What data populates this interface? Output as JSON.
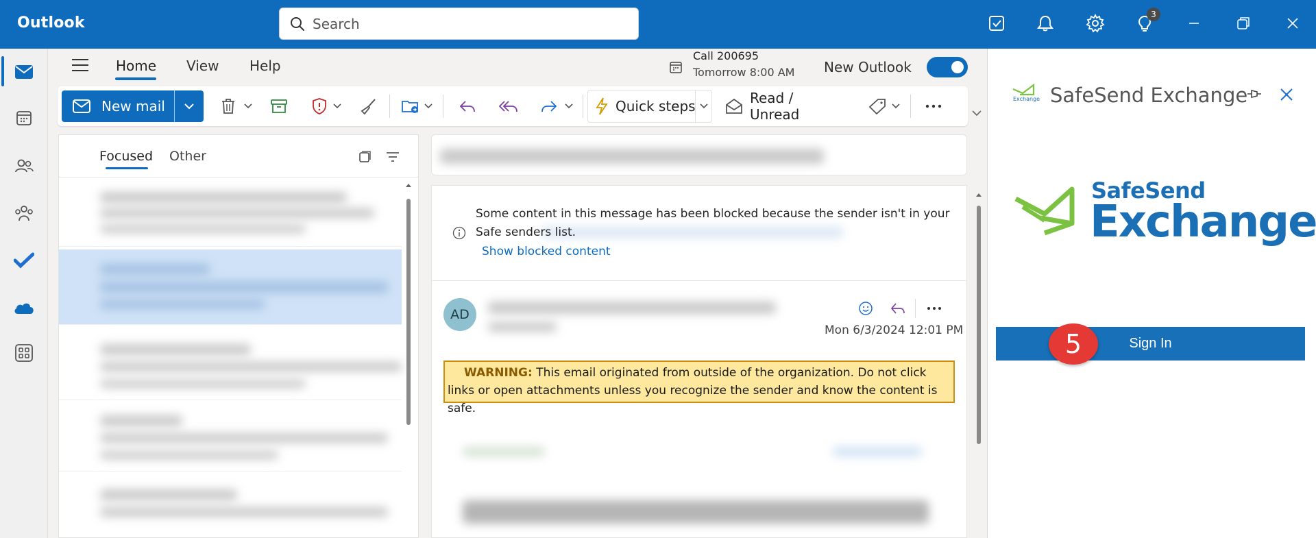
{
  "app": {
    "title": "Outlook",
    "accent_color": "#0f6cbd"
  },
  "search": {
    "placeholder": "Search"
  },
  "titlebar": {
    "icons": [
      "todo-icon",
      "bell-icon",
      "gear-icon",
      "lightbulb-icon",
      "minimize-icon",
      "restore-icon",
      "close-icon"
    ],
    "tips_badge_count": "3"
  },
  "left_rail": {
    "items": [
      "mail-icon",
      "calendar-icon",
      "people-icon",
      "groups-icon",
      "todo-icon",
      "onedrive-icon",
      "apps-icon"
    ],
    "active": "mail-icon"
  },
  "nav": {
    "tabs": [
      {
        "label": "Home",
        "active": true
      },
      {
        "label": "View",
        "active": false
      },
      {
        "label": "Help",
        "active": false
      }
    ]
  },
  "reminder": {
    "title": "Call 200695",
    "time": "Tomorrow 8:00 AM"
  },
  "new_outlook": {
    "label": "New Outlook",
    "enabled": true
  },
  "ribbon": {
    "new_mail_label": "New mail",
    "quick_steps_label": "Quick steps",
    "read_unread_label": "Read / Unread",
    "tools": [
      "delete-icon",
      "archive-icon",
      "report-icon",
      "sweep-icon",
      "move-icon",
      "reply-icon",
      "reply-all-icon",
      "forward-icon",
      "tag-icon",
      "more-icon"
    ]
  },
  "message_list": {
    "tabs": [
      {
        "label": "Focused",
        "active": true
      },
      {
        "label": "Other",
        "active": false
      }
    ]
  },
  "reading_pane": {
    "blocked_notice": "Some content in this message has been blocked because the sender isn't in your Safe senders list.",
    "show_blocked_link": "Show blocked content",
    "sender_initials": "AD",
    "date": "Mon 6/3/2024 12:01 PM",
    "warning_label": "WARNING:",
    "warning_text": "This email originated from outside of the organization. Do not click links or open attachments unless you recognize the sender and know the content is safe."
  },
  "addin": {
    "title": "SafeSend Exchange",
    "logo_line1": "SafeSend",
    "logo_line2": "Exchange",
    "small_logo_text": "Exchange",
    "sign_in_label": "Sign In",
    "step_badge": "5",
    "logo_green": "#7cc242",
    "logo_blue": "#1b6fb5"
  }
}
